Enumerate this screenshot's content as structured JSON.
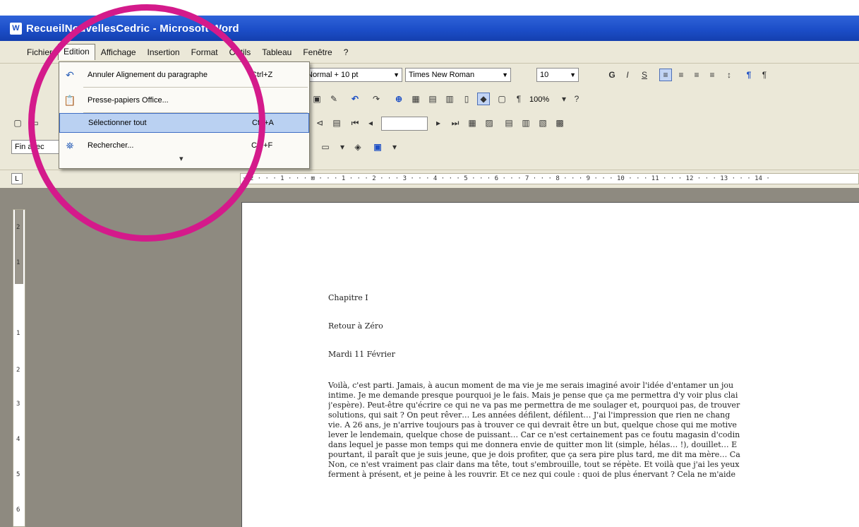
{
  "window": {
    "title": "RecueilNouvellesCedric - Microsoft Word",
    "app_icon": "word-icon"
  },
  "menu": {
    "items": [
      "Fichier",
      "Edition",
      "Affichage",
      "Insertion",
      "Format",
      "Outils",
      "Tableau",
      "Fenêtre",
      "?"
    ]
  },
  "edition_menu": {
    "items": [
      {
        "label": "Annuler Alignement du paragraphe",
        "shortcut": "Ctrl+Z",
        "icon": "undo-icon"
      },
      {
        "label": "Presse-papiers Office...",
        "shortcut": "",
        "icon": "clipboard-icon"
      },
      {
        "label": "Sélectionner tout",
        "shortcut": "Ctrl+A",
        "icon": ""
      },
      {
        "label": "Rechercher...",
        "shortcut": "Ctrl+F",
        "icon": "binoculars-icon"
      }
    ],
    "more_glyph": "▾"
  },
  "formatting": {
    "style": "Normal + 10 pt",
    "font": "Times New Roman",
    "size": "10",
    "bold": "G",
    "italic": "I",
    "underline": "S"
  },
  "standard": {
    "zoom": "100%"
  },
  "find_box": {
    "value": "Fin avec"
  },
  "ruler": {
    "text": "· 2 · · · 1 · · · ⊠ · · · 1 · · · 2 · · · 3 · · · 4 · · · 5 · · · 6 · · · 7 · · · 8 · · · 9 · · · 10 · · · 11 · · · 12 · · · 13 · · · 14 ·",
    "vertical_ticks": [
      "2",
      "1",
      "1",
      "2",
      "3",
      "4",
      "5",
      "6"
    ]
  },
  "document": {
    "headings": [
      "Chapitre I",
      "Retour à Zéro",
      "Mardi 11 Février"
    ],
    "lines": [
      "Voilà, c'est parti. Jamais, à aucun moment de ma vie je me serais imaginé avoir l'idée d'entamer un jou",
      "intime. Je me demande presque pourquoi je le fais. Mais je pense que ça me permettra d'y voir plus clai",
      "j'espère). Peut-être qu'écrire ce qui ne va pas me permettra de me soulager et, pourquoi pas, de trouver",
      "solutions, qui sait ? On peut rêver… Les années défilent, défilent… J'ai l'impression que rien ne chang",
      "vie.  A 26 ans, je n'arrive toujours pas à trouver ce qui devrait être un but, quelque chose qui me motive",
      "lever le lendemain, quelque chose de puissant… Car ce n'est certainement pas ce foutu magasin d'codin",
      "dans lequel je passe mon temps qui me donnera envie de quitter mon lit (simple, hélas… !), douillet… E",
      "pourtant, il paraît que je suis jeune, que je dois profiter, que ça sera pire plus tard, me dit ma mère… Ca",
      "Non, ce n'est vraiment pas clair dans ma tête, tout s'embrouille, tout se répète. Et voilà que j'ai les yeux",
      "ferment à présent, et je peine à les rouvrir. Et ce nez qui coule : quoi de plus énervant ? Cela ne m'aide"
    ]
  },
  "colors": {
    "title_bar": "#1c4ec8",
    "menu_bg": "#ebe8d8",
    "highlight_ring": "#d41a8b",
    "selected_item": "#bad1f2"
  }
}
